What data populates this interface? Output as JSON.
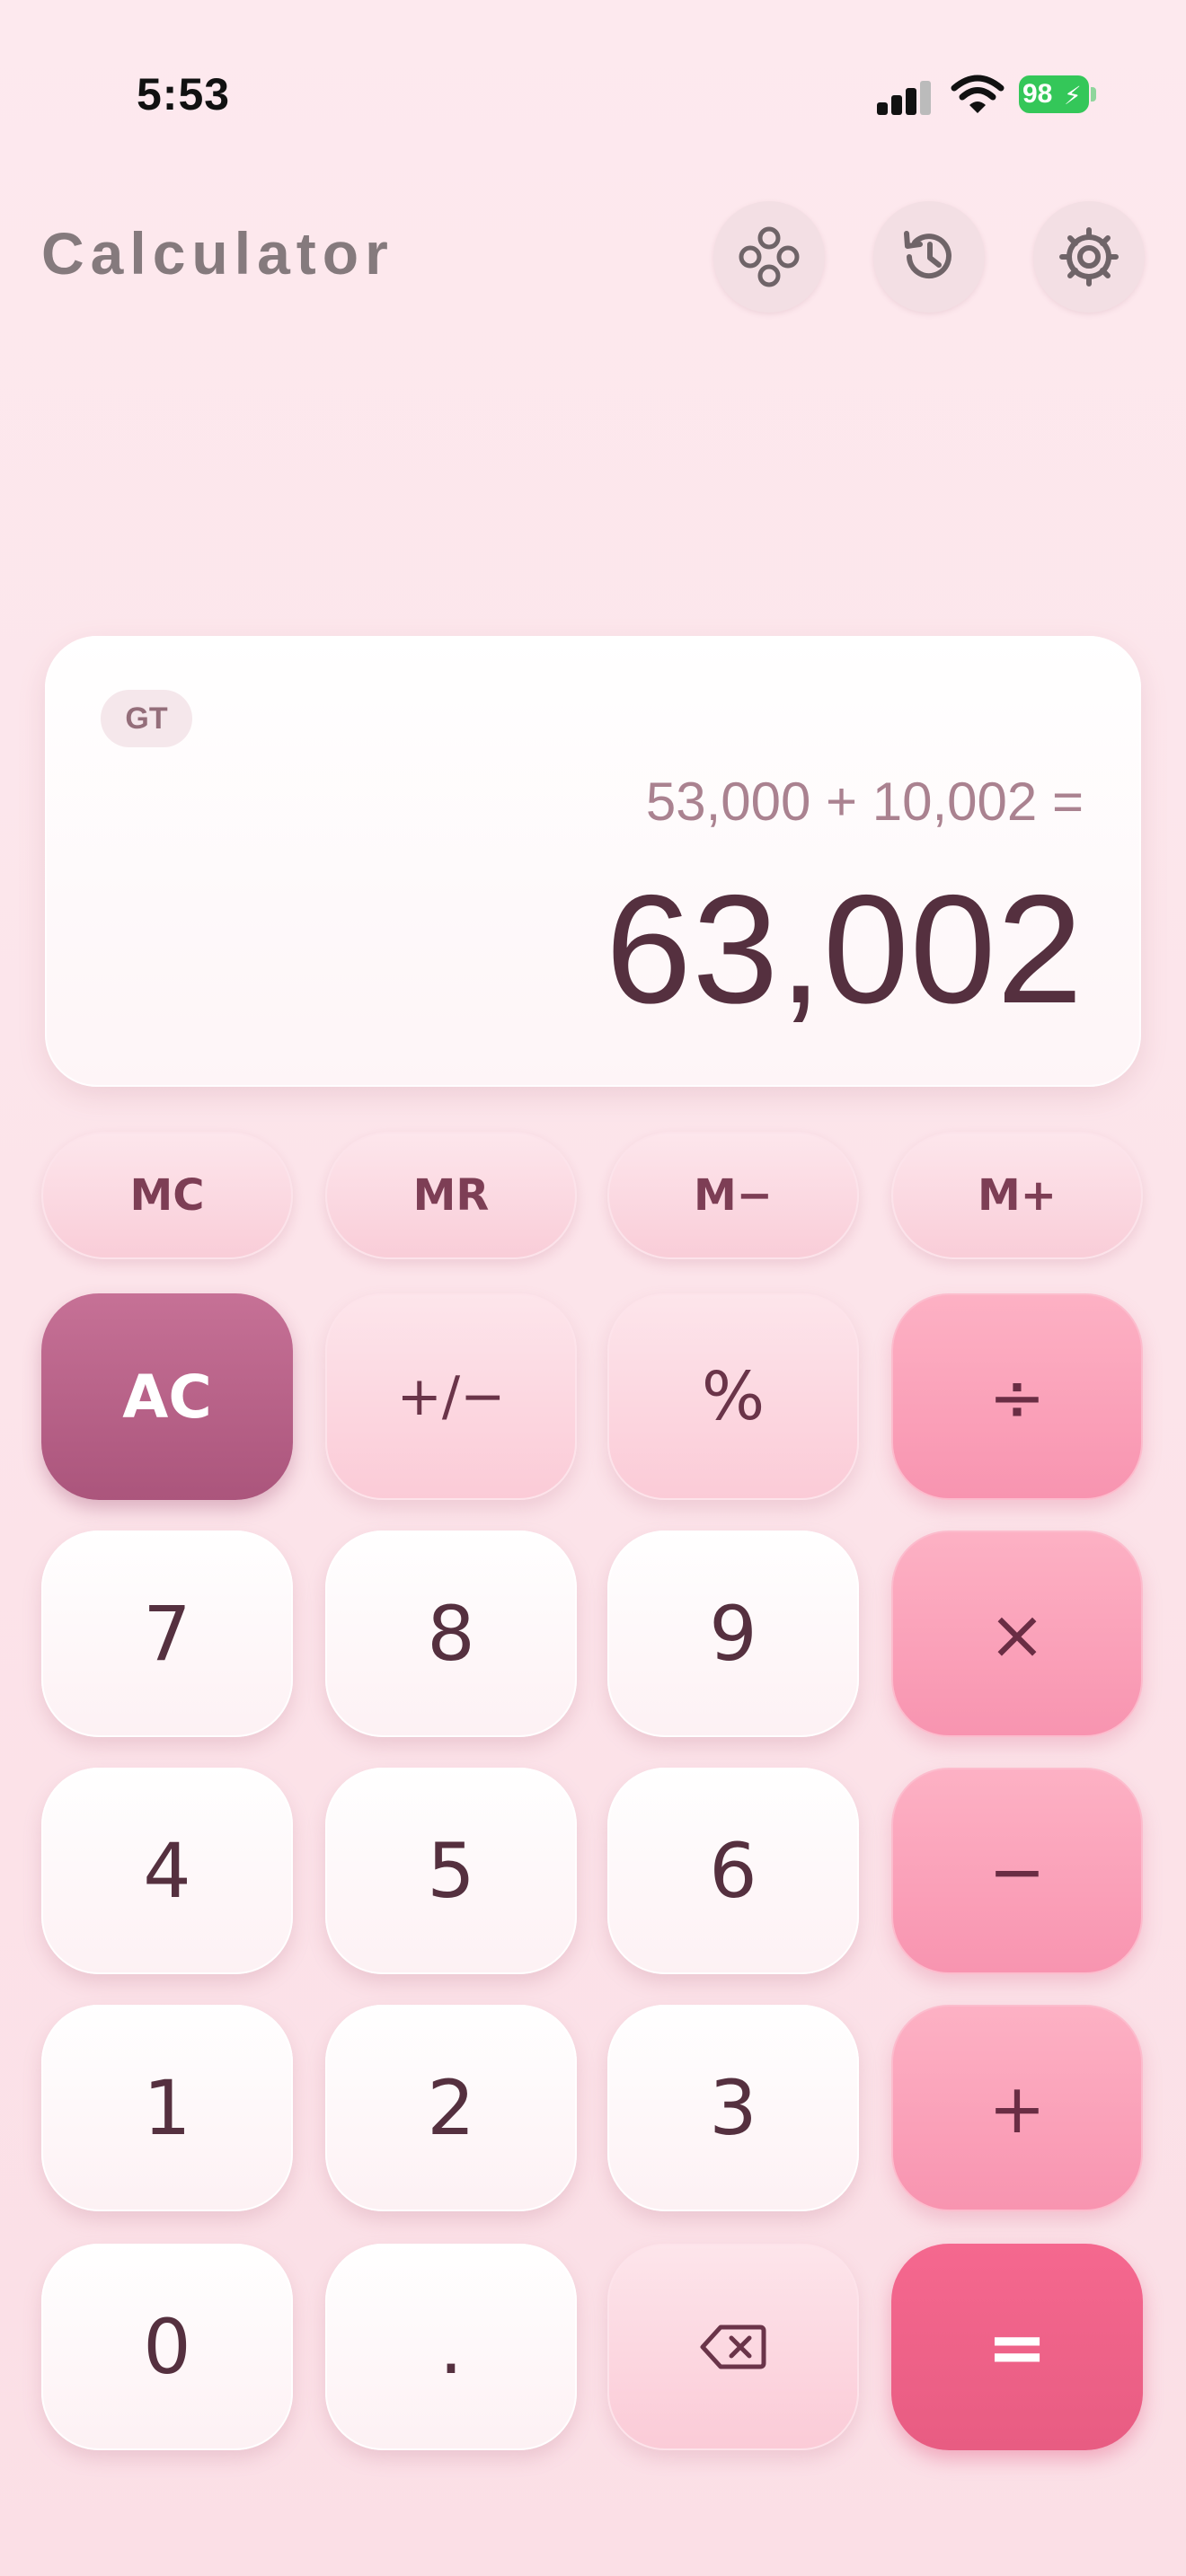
{
  "status_bar": {
    "time": "5:53",
    "battery": "98"
  },
  "header": {
    "title": "Calculator",
    "buttons": [
      {
        "name": "themes-icon"
      },
      {
        "name": "history-icon"
      },
      {
        "name": "settings-icon"
      }
    ]
  },
  "display": {
    "badge": "GT",
    "expression": "53,000 + 10,002 =",
    "result": "63,002"
  },
  "memory_keys": {
    "mc": "MC",
    "mr": "MR",
    "m_minus": "M−",
    "m_plus": "M+"
  },
  "keys": {
    "ac": "AC",
    "plus_minus": "+/−",
    "percent": "%",
    "divide": "÷",
    "seven": "7",
    "eight": "8",
    "nine": "9",
    "multiply": "×",
    "four": "4",
    "five": "5",
    "six": "6",
    "minus": "−",
    "one": "1",
    "two": "2",
    "three": "3",
    "plus": "+",
    "zero": "0",
    "decimal": ".",
    "backspace": "backspace-icon",
    "equals": "="
  },
  "colors": {
    "background": "#fde9ee",
    "text": "#55303f",
    "operator": "#f894b0",
    "ac": "#ab557c",
    "equals": "#e85c82",
    "battery": "#34c759"
  }
}
